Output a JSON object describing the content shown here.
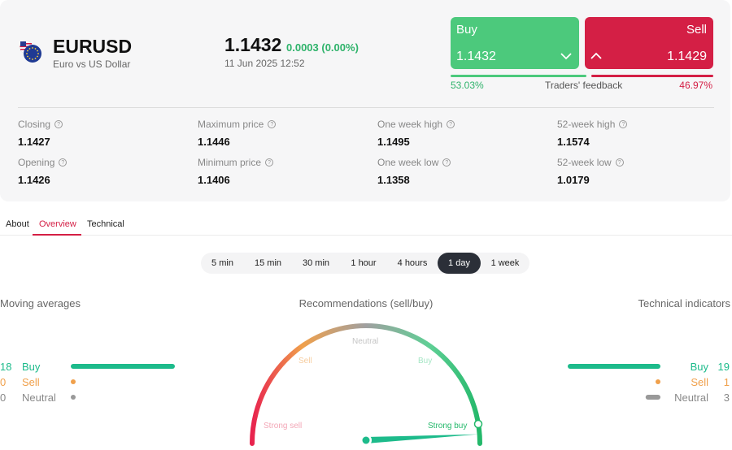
{
  "instrument": {
    "symbol": "EURUSD",
    "description": "Euro vs US Dollar",
    "price": "1.1432",
    "change": "0.0003 (0.00%)",
    "datetime": "11 Jun 2025 12:52"
  },
  "trade": {
    "buy_label": "Buy",
    "buy_price": "1.1432",
    "sell_label": "Sell",
    "sell_price": "1.1429"
  },
  "feedback": {
    "buy_pct": "53.03%",
    "label": "Traders' feedback",
    "sell_pct": "46.97%",
    "buy_share": 0.5303
  },
  "stats": [
    {
      "label": "Closing",
      "value": "1.1427"
    },
    {
      "label": "Maximum price",
      "value": "1.1446"
    },
    {
      "label": "One week high",
      "value": "1.1495"
    },
    {
      "label": "52-week high",
      "value": "1.1574"
    },
    {
      "label": "Opening",
      "value": "1.1426"
    },
    {
      "label": "Minimum price",
      "value": "1.1406"
    },
    {
      "label": "One week low",
      "value": "1.1358"
    },
    {
      "label": "52-week low",
      "value": "1.0179"
    }
  ],
  "tabs": [
    "About",
    "Overview",
    "Technical"
  ],
  "active_tab": "Overview",
  "timeframes": [
    "5 min",
    "15 min",
    "30 min",
    "1 hour",
    "4 hours",
    "1 day",
    "1 week"
  ],
  "active_timeframe": "1 day",
  "moving_averages": {
    "title": "Moving averages",
    "rows": [
      {
        "count": "18",
        "label": "Buy",
        "share": 1.0
      },
      {
        "count": "0",
        "label": "Sell",
        "share": 0.0
      },
      {
        "count": "0",
        "label": "Neutral",
        "share": 0.0
      }
    ]
  },
  "recommendations": {
    "title": "Recommendations (sell/buy)",
    "labels": {
      "strong_sell": "Strong sell",
      "sell": "Sell",
      "neutral": "Neutral",
      "buy": "Buy",
      "strong_buy": "Strong buy"
    },
    "needle_level": 0.94
  },
  "technical_indicators": {
    "title": "Technical indicators",
    "rows": [
      {
        "count": "19",
        "label": "Buy",
        "share": 1.0
      },
      {
        "count": "1",
        "label": "Sell",
        "share": 0.05
      },
      {
        "count": "3",
        "label": "Neutral",
        "share": 0.16
      }
    ]
  },
  "colors": {
    "buy": "#4cc97c",
    "buy_text": "#2fb36b",
    "sell": "#d41f45",
    "ma_buy": "#1dbb8b",
    "ma_sell": "#f0a04b",
    "neutral": "#999999",
    "timeframe_active": "#2b2f38"
  }
}
